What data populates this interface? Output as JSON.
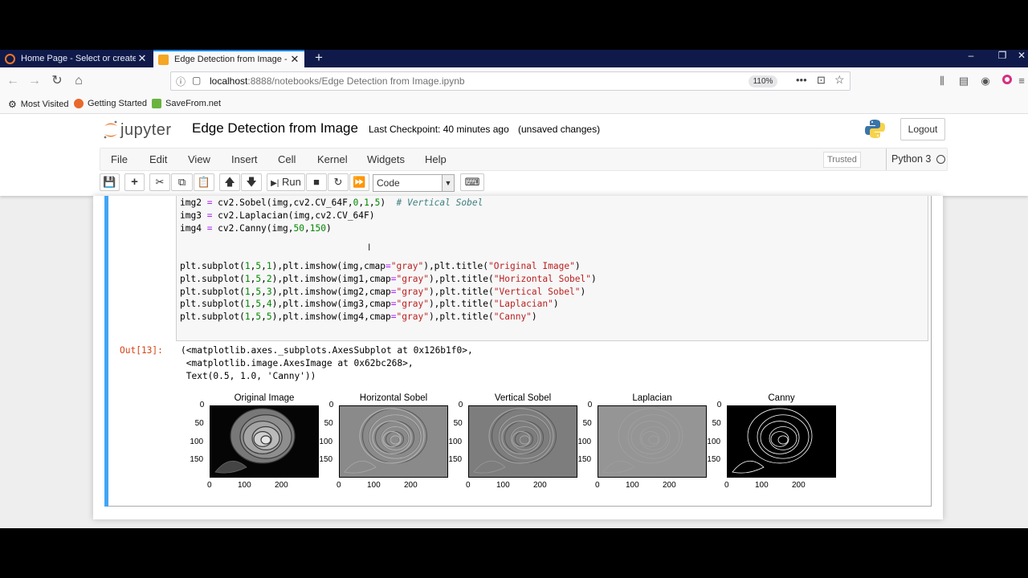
{
  "browser": {
    "tabs": [
      {
        "title": "Home Page - Select or create a",
        "active": false
      },
      {
        "title": "Edge Detection from Image - J",
        "active": true
      }
    ],
    "new_tab": "+",
    "url_host": "localhost",
    "url_path": ":8888/notebooks/Edge Detection from Image.ipynb",
    "zoom": "110%",
    "bookmarks": [
      "Most Visited",
      "Getting Started",
      "SaveFrom.net"
    ]
  },
  "jupyter": {
    "logo_text": "jupyter",
    "notebook_title": "Edge Detection from Image",
    "checkpoint": "Last Checkpoint: 40 minutes ago",
    "unsaved": "(unsaved changes)",
    "logout": "Logout",
    "menus": [
      "File",
      "Edit",
      "View",
      "Insert",
      "Cell",
      "Kernel",
      "Widgets",
      "Help"
    ],
    "trusted": "Trusted",
    "kernel": "Python 3",
    "run_label": "Run",
    "cell_type": "Code"
  },
  "cell": {
    "code_lines": [
      [
        {
          "t": "img2 "
        },
        {
          "t": "=",
          "c": "op"
        },
        {
          "t": " cv2.Sobel(img,cv2.CV_64F,"
        },
        {
          "t": "0",
          "c": "num"
        },
        {
          "t": ","
        },
        {
          "t": "1",
          "c": "num"
        },
        {
          "t": ","
        },
        {
          "t": "5",
          "c": "num"
        },
        {
          "t": ")  "
        },
        {
          "t": "# Vertical Sobel",
          "c": "cm"
        }
      ],
      [
        {
          "t": "img3 "
        },
        {
          "t": "=",
          "c": "op"
        },
        {
          "t": " cv2.Laplacian(img,cv2.CV_64F)"
        }
      ],
      [
        {
          "t": "img4 "
        },
        {
          "t": "=",
          "c": "op"
        },
        {
          "t": " cv2.Canny(img,"
        },
        {
          "t": "50",
          "c": "num"
        },
        {
          "t": ","
        },
        {
          "t": "150",
          "c": "num"
        },
        {
          "t": ")"
        }
      ],
      [
        {
          "t": ""
        }
      ],
      [
        {
          "t": ""
        }
      ],
      [
        {
          "t": "plt.subplot("
        },
        {
          "t": "1",
          "c": "num"
        },
        {
          "t": ","
        },
        {
          "t": "5",
          "c": "num"
        },
        {
          "t": ","
        },
        {
          "t": "1",
          "c": "num"
        },
        {
          "t": "),plt.imshow(img,cmap"
        },
        {
          "t": "=",
          "c": "op"
        },
        {
          "t": "\"gray\"",
          "c": "str"
        },
        {
          "t": "),plt.title("
        },
        {
          "t": "\"Original Image\"",
          "c": "str"
        },
        {
          "t": ")"
        }
      ],
      [
        {
          "t": "plt.subplot("
        },
        {
          "t": "1",
          "c": "num"
        },
        {
          "t": ","
        },
        {
          "t": "5",
          "c": "num"
        },
        {
          "t": ","
        },
        {
          "t": "2",
          "c": "num"
        },
        {
          "t": "),plt.imshow(img1,cmap"
        },
        {
          "t": "=",
          "c": "op"
        },
        {
          "t": "\"gray\"",
          "c": "str"
        },
        {
          "t": "),plt.title("
        },
        {
          "t": "\"Horizontal Sobel\"",
          "c": "str"
        },
        {
          "t": ")"
        }
      ],
      [
        {
          "t": "plt.subplot("
        },
        {
          "t": "1",
          "c": "num"
        },
        {
          "t": ","
        },
        {
          "t": "5",
          "c": "num"
        },
        {
          "t": ","
        },
        {
          "t": "3",
          "c": "num"
        },
        {
          "t": "),plt.imshow(img2,cmap"
        },
        {
          "t": "=",
          "c": "op"
        },
        {
          "t": "\"gray\"",
          "c": "str"
        },
        {
          "t": "),plt.title("
        },
        {
          "t": "\"Vertical Sobel\"",
          "c": "str"
        },
        {
          "t": ")"
        }
      ],
      [
        {
          "t": "plt.subplot("
        },
        {
          "t": "1",
          "c": "num"
        },
        {
          "t": ","
        },
        {
          "t": "5",
          "c": "num"
        },
        {
          "t": ","
        },
        {
          "t": "4",
          "c": "num"
        },
        {
          "t": "),plt.imshow(img3,cmap"
        },
        {
          "t": "=",
          "c": "op"
        },
        {
          "t": "\"gray\"",
          "c": "str"
        },
        {
          "t": "),plt.title("
        },
        {
          "t": "\"Laplacian\"",
          "c": "str"
        },
        {
          "t": ")"
        }
      ],
      [
        {
          "t": "plt.subplot("
        },
        {
          "t": "1",
          "c": "num"
        },
        {
          "t": ","
        },
        {
          "t": "5",
          "c": "num"
        },
        {
          "t": ","
        },
        {
          "t": "5",
          "c": "num"
        },
        {
          "t": "),plt.imshow(img4,cmap"
        },
        {
          "t": "=",
          "c": "op"
        },
        {
          "t": "\"gray\"",
          "c": "str"
        },
        {
          "t": "),plt.title("
        },
        {
          "t": "\"Canny\"",
          "c": "str"
        },
        {
          "t": ")"
        }
      ]
    ],
    "out_prompt": "Out[13]:",
    "out_lines": [
      "(<matplotlib.axes._subplots.AxesSubplot at 0x126b1f0>,",
      " <matplotlib.image.AxesImage at 0x62bc268>,",
      " Text(0.5, 1.0, 'Canny'))"
    ]
  },
  "figure": {
    "panels": [
      {
        "title": "Original Image",
        "style": "original"
      },
      {
        "title": "Horizontal Sobel",
        "style": "sobelx"
      },
      {
        "title": "Vertical Sobel",
        "style": "sobely"
      },
      {
        "title": "Laplacian",
        "style": "laplacian"
      },
      {
        "title": "Canny",
        "style": "canny"
      }
    ],
    "y_ticks": [
      "0",
      "50",
      "100",
      "150"
    ],
    "x_ticks": [
      "0",
      "100",
      "200"
    ]
  }
}
